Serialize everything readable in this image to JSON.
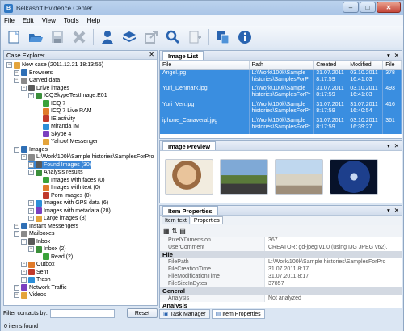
{
  "app": {
    "title": "Belkasoft Evidence Center"
  },
  "window_controls": {
    "minimize": "–",
    "maximize": "□",
    "close": "✕"
  },
  "menu": [
    "File",
    "Edit",
    "View",
    "Tools",
    "Help"
  ],
  "toolbar": [
    "new-case-icon",
    "open-folder-icon",
    "save-icon",
    "delete-icon",
    "user-icon",
    "layers-icon",
    "export-icon",
    "search-icon",
    "add-icon",
    "copy-icon",
    "info-icon"
  ],
  "case_explorer": {
    "title": "Case Explorer",
    "close": "✕",
    "nodes": [
      {
        "label": "New case (2011.12.21 18:13:55)",
        "indent": 0
      },
      {
        "label": "Browsers",
        "indent": 1
      },
      {
        "label": "Carved data",
        "indent": 1
      },
      {
        "label": "Drive images",
        "indent": 2
      },
      {
        "label": "ICQSkypeTestImage.E01",
        "indent": 3
      },
      {
        "label": "ICQ 7",
        "indent": 4
      },
      {
        "label": "ICQ 7 Live RAM",
        "indent": 4
      },
      {
        "label": "IE activity",
        "indent": 4
      },
      {
        "label": "Miranda IM",
        "indent": 4
      },
      {
        "label": "Skype 4",
        "indent": 4
      },
      {
        "label": "Yahoo! Messenger",
        "indent": 4
      },
      {
        "label": "Images",
        "indent": 1
      },
      {
        "label": "L:\\Work\\100k\\Sample histories\\SamplesForPro",
        "indent": 2
      },
      {
        "label": "Found Images (30)",
        "indent": 3,
        "selected": true
      },
      {
        "label": "Analysis results",
        "indent": 3
      },
      {
        "label": "Images with faces (0)",
        "indent": 4
      },
      {
        "label": "Images with text (0)",
        "indent": 4
      },
      {
        "label": "Porn images (0)",
        "indent": 4
      },
      {
        "label": "Images with GPS data (6)",
        "indent": 3
      },
      {
        "label": "Images with metadata (28)",
        "indent": 3
      },
      {
        "label": "Large images (8)",
        "indent": 3
      },
      {
        "label": "Instant Messengers",
        "indent": 1
      },
      {
        "label": "Mailboxes",
        "indent": 1
      },
      {
        "label": "Inbox",
        "indent": 2
      },
      {
        "label": "Inbox (2)",
        "indent": 3
      },
      {
        "label": "Read (2)",
        "indent": 4
      },
      {
        "label": "Outbox",
        "indent": 2
      },
      {
        "label": "Sent",
        "indent": 2
      },
      {
        "label": "Trash",
        "indent": 2
      },
      {
        "label": "Network Traffic",
        "indent": 1
      },
      {
        "label": "Videos",
        "indent": 1
      }
    ]
  },
  "filter": {
    "label": "Filter contacts by:",
    "value": "",
    "button": "Reset"
  },
  "status": {
    "text": "0 items found"
  },
  "item_list": {
    "tab": "Image List",
    "columns": [
      "File",
      "Path",
      "Created",
      "Modified",
      "File"
    ],
    "rows": [
      {
        "file": "Angel.jpg",
        "path": "L:\\Work\\100k\\Sample histories\\SamplesForPr",
        "created": "31.07.2011 8:17:59",
        "modified": "03.10.2011 16:41:03",
        "size": "378"
      },
      {
        "file": "Yuri_Denmark.jpg",
        "path": "L:\\Work\\100k\\Sample histories\\SamplesForPr",
        "created": "31.07.2011 8:17:59",
        "modified": "03.10.2011 16:41:03",
        "size": "493"
      },
      {
        "file": "Yuri_Ven.jpg",
        "path": "L:\\Work\\100k\\Sample histories\\SamplesForPr",
        "created": "31.07.2011 8:17:59",
        "modified": "31.07.2011 16:40:54",
        "size": "416"
      },
      {
        "file": "iphone_Canaveral.jpg",
        "path": "L:\\Work\\100k\\Sample histories\\SamplesForPr",
        "created": "31.07.2011 8:17:59",
        "modified": "03.10.2011 16:39:27",
        "size": "361"
      }
    ]
  },
  "image_preview": {
    "tab": "Image Preview"
  },
  "item_properties": {
    "tab": "Item Properties",
    "subtabs": [
      "Item text",
      "Properties"
    ],
    "rows_top": [
      {
        "k": "PixelYDimension",
        "v": "367"
      },
      {
        "k": "UserComment",
        "v": "CREATOR: gd-jpeg v1.0 (using IJG JPEG v62),"
      }
    ],
    "cat_file": "File",
    "rows_file": [
      {
        "k": "FilePath",
        "v": "L:\\Work\\100k\\Sample histories\\SamplesForPro"
      },
      {
        "k": "FileCreationTime",
        "v": "31.07.2011 8:17"
      },
      {
        "k": "FileModificationTime",
        "v": "31.07.2011 8:17"
      },
      {
        "k": "FileSizeInBytes",
        "v": "37857"
      }
    ],
    "cat_general": "General",
    "rows_general": [
      {
        "k": "Analysis",
        "v": "Not analyzed"
      }
    ],
    "cut_label": "Analysis"
  },
  "bottom_tabs": [
    "Task Manager",
    "Item Properties"
  ]
}
